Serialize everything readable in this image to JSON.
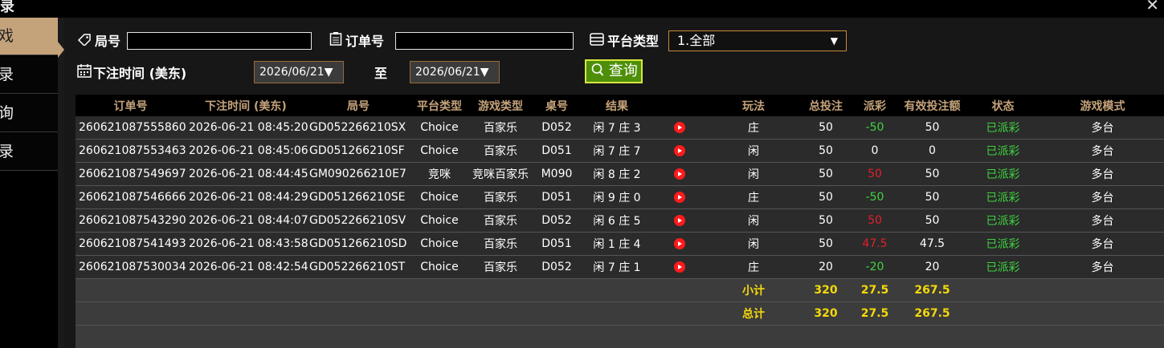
{
  "window": {
    "title": "录",
    "close_glyph": "✕"
  },
  "sidebar": {
    "items": [
      {
        "label": "戏",
        "active": true
      },
      {
        "label": "录"
      },
      {
        "label": "询"
      },
      {
        "label": "录"
      }
    ]
  },
  "filters": {
    "round_label": "局号",
    "round_value": "",
    "order_label": "订单号",
    "order_value": "",
    "platform_label": "平台类型",
    "platform_value": "1.全部",
    "bet_time_label": "下注时间 (美东)",
    "date_from": "2026/06/21▼",
    "to_label": "至",
    "date_to": "2026/06/21▼",
    "query_label": "查询"
  },
  "table": {
    "headers": [
      "订单号",
      "下注时间 (美东)",
      "局号",
      "平台类型",
      "游戏类型",
      "桌号",
      "结果",
      "",
      "玩法",
      "总投注",
      "派彩",
      "有效投注额",
      "状态",
      "游戏模式"
    ],
    "rows": [
      [
        "260621087555860",
        "2026-06-21 08:45:20",
        "GD052266210SX",
        "Choice",
        "百家乐",
        "D052",
        "闲 7 庄 3",
        "庄",
        "50",
        "-50",
        "50",
        "已派彩",
        "多台"
      ],
      [
        "260621087553463",
        "2026-06-21 08:45:06",
        "GD051266210SF",
        "Choice",
        "百家乐",
        "D051",
        "闲 7 庄 7",
        "闲",
        "50",
        "0",
        "0",
        "已派彩",
        "多台"
      ],
      [
        "260621087549697",
        "2026-06-21 08:44:45",
        "GM090266210E7",
        "竞咪",
        "竞咪百家乐",
        "M090",
        "闲 8 庄 2",
        "闲",
        "50",
        "50",
        "50",
        "已派彩",
        "多台"
      ],
      [
        "260621087546666",
        "2026-06-21 08:44:29",
        "GD051266210SE",
        "Choice",
        "百家乐",
        "D051",
        "闲 9 庄 0",
        "庄",
        "50",
        "-50",
        "50",
        "已派彩",
        "多台"
      ],
      [
        "260621087543290",
        "2026-06-21 08:44:07",
        "GD052266210SV",
        "Choice",
        "百家乐",
        "D052",
        "闲 6 庄 5",
        "闲",
        "50",
        "50",
        "50",
        "已派彩",
        "多台"
      ],
      [
        "260621087541493",
        "2026-06-21 08:43:58",
        "GD051266210SD",
        "Choice",
        "百家乐",
        "D051",
        "闲 1 庄 4",
        "闲",
        "50",
        "47.5",
        "47.5",
        "已派彩",
        "多台"
      ],
      [
        "260621087530034",
        "2026-06-21 08:42:54",
        "GD052266210ST",
        "Choice",
        "百家乐",
        "D052",
        "闲 7 庄 1",
        "庄",
        "20",
        "-20",
        "20",
        "已派彩",
        "多台"
      ]
    ],
    "subtotal": {
      "label": "小计",
      "total_bet": "320",
      "payout": "27.5",
      "valid_bet": "267.5"
    },
    "total": {
      "label": "总计",
      "total_bet": "320",
      "payout": "27.5",
      "valid_bet": "267.5"
    }
  },
  "colors": {
    "accent_gold": "#c4a27a",
    "payout_negative_green": "#3ed33e",
    "payout_positive_red": "#e0202a",
    "status_green": "#3ed33e",
    "sum_yellow": "#f5d90a",
    "query_green": "#4e8f0a"
  },
  "icons": {
    "round": "tag-icon",
    "order": "clipboard-icon",
    "platform": "list-icon",
    "bet_time": "calendar-icon",
    "query": "search-icon",
    "video": "play-icon"
  }
}
